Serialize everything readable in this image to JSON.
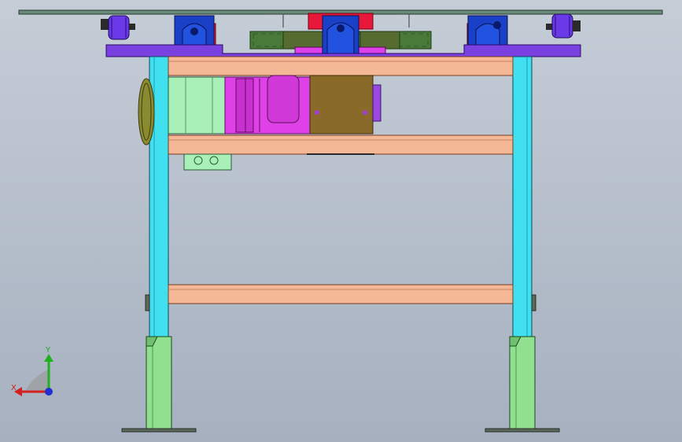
{
  "viewport": {
    "background_top": "#c5cdd7",
    "background_bottom": "#a6b0bf"
  },
  "triad": {
    "x_label": "X",
    "y_label": "Y",
    "x_color": "#d42020",
    "y_color": "#20b020",
    "z_color": "#2030d0"
  },
  "colors": {
    "plate": "#6a8a7a",
    "columns": "#40e0f0",
    "crossbeam": "#f5b896",
    "feet": "#90e090",
    "carriage": "#7a40e0",
    "motor": "#a8f0b8",
    "gearbox": "#e040e8",
    "gear_housing": "#8a6a28",
    "blue_block": "#1a40c8",
    "red_block": "#e8183a",
    "chain": "#4a7a3a"
  }
}
